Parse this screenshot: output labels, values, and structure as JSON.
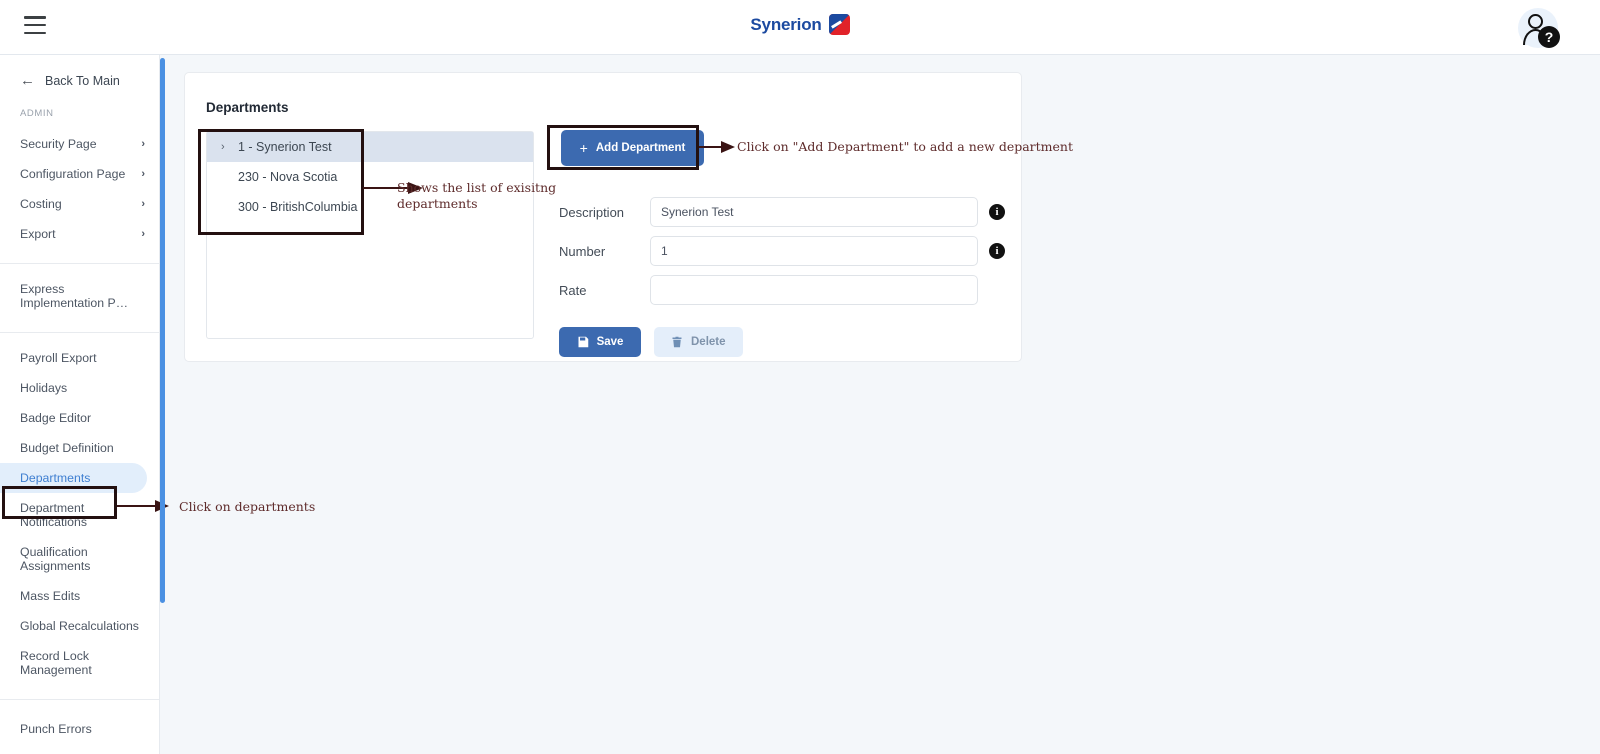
{
  "topbar": {
    "menu_icon": "hamburger-icon",
    "brand_name": "Synerion",
    "help_badge": "?"
  },
  "sidebar": {
    "back_label": "Back To Main",
    "section_label": "ADMIN",
    "expandable_items": [
      {
        "label": "Security Page",
        "chevron": "›"
      },
      {
        "label": "Configuration Page",
        "chevron": "›"
      },
      {
        "label": "Costing",
        "chevron": "›"
      },
      {
        "label": "Export",
        "chevron": "›"
      }
    ],
    "group_express": [
      {
        "label": "Express Implementation P…"
      }
    ],
    "group_admin_tools": [
      {
        "label": "Payroll Export",
        "active": false
      },
      {
        "label": "Holidays",
        "active": false
      },
      {
        "label": "Badge Editor",
        "active": false
      },
      {
        "label": "Budget Definition",
        "active": false
      },
      {
        "label": "Departments",
        "active": true
      },
      {
        "label": "Department Notifications",
        "active": false
      },
      {
        "label": "Qualification Assignments",
        "active": false
      },
      {
        "label": "Mass Edits",
        "active": false
      },
      {
        "label": "Global Recalculations",
        "active": false
      },
      {
        "label": "Record Lock Management",
        "active": false
      }
    ],
    "group_errors": [
      {
        "label": "Punch Errors"
      }
    ]
  },
  "main": {
    "card_title": "Departments",
    "department_list": [
      {
        "label": "1 - Synerion Test",
        "selected": true,
        "has_chevron": true
      },
      {
        "label": "230 - Nova Scotia",
        "selected": false,
        "has_chevron": false
      },
      {
        "label": "300 - BritishColumbia",
        "selected": false,
        "has_chevron": false
      }
    ],
    "add_button": {
      "label": "Add Department",
      "plus": "+"
    },
    "fields": [
      {
        "label": "Description",
        "value": "Synerion Test",
        "placeholder": "",
        "info": true
      },
      {
        "label": "Number",
        "value": "1",
        "placeholder": "",
        "info": true
      },
      {
        "label": "Rate",
        "value": "",
        "placeholder": "",
        "info": false
      }
    ],
    "save_button": "Save",
    "delete_button": "Delete"
  },
  "annotations": [
    {
      "id": "add-department",
      "text": "Click on \"Add Department\" to add a new department"
    },
    {
      "id": "list",
      "line1": "Shows the list of exisitng",
      "line2": "departments"
    },
    {
      "id": "sidebar",
      "text": "Click on departments"
    }
  ],
  "colors": {
    "brand_blue": "#1c4aa0",
    "brand_red": "#e12229",
    "accent_button": "#3c6ab0",
    "scrollbar": "#4a90e2",
    "page_bg": "#f4f7fa",
    "annotation": "#5e2b2b",
    "active_item_bg": "#e2eefb"
  }
}
